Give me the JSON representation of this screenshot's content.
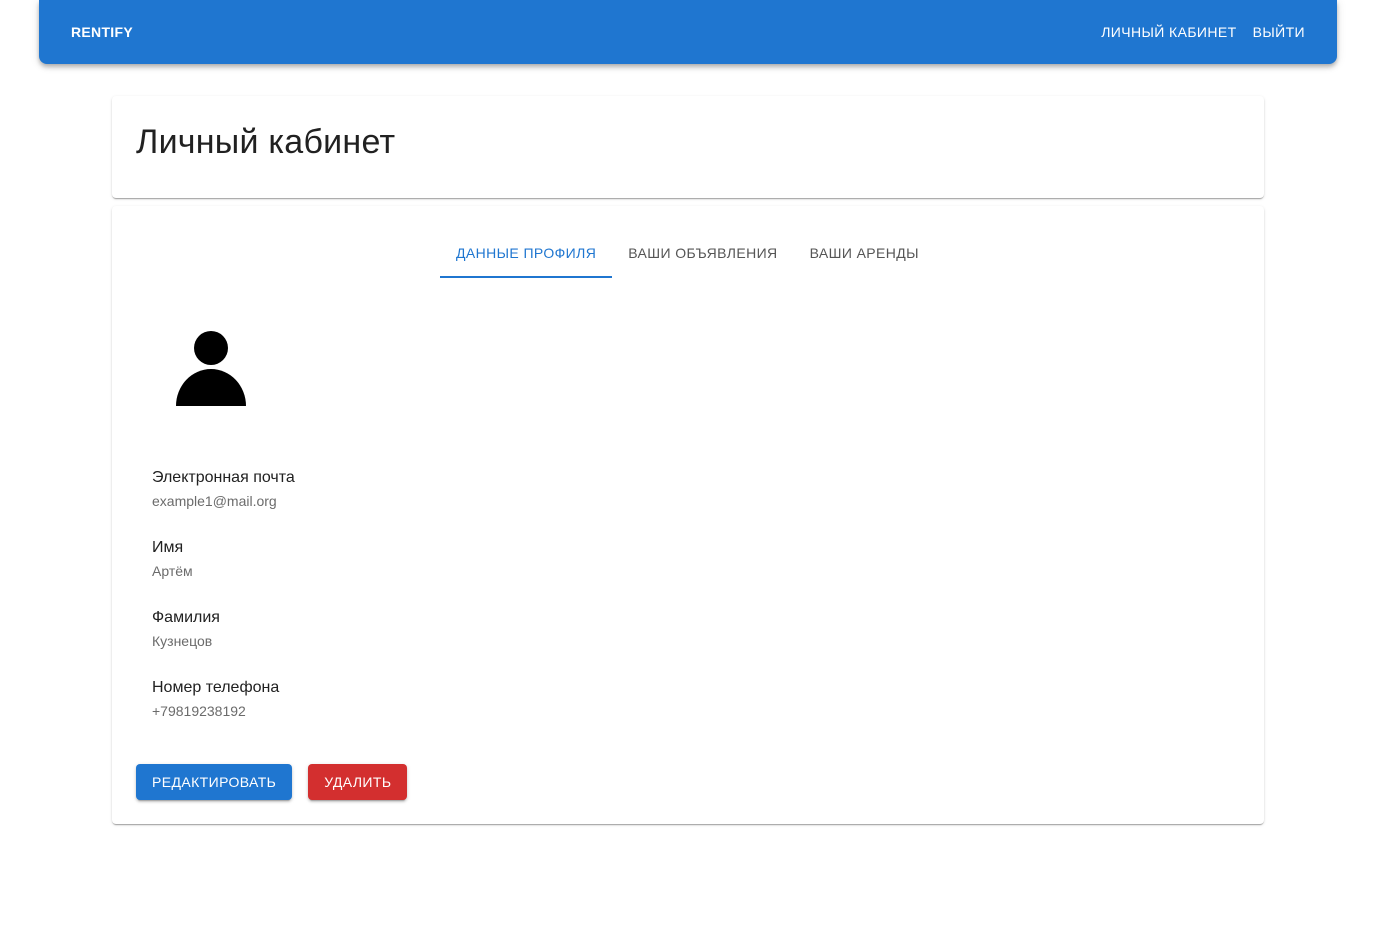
{
  "appbar": {
    "brand": "RENTIFY",
    "nav": [
      {
        "label": "ЛИЧНЫЙ КАБИНЕТ"
      },
      {
        "label": "ВЫЙТИ"
      }
    ],
    "accent_color": "#1f76d0"
  },
  "header": {
    "title": "Личный кабинет"
  },
  "tabs": [
    {
      "label": "ДАННЫЕ ПРОФИЛЯ",
      "active": true
    },
    {
      "label": "ВАШИ ОБЪЯВЛЕНИЯ",
      "active": false
    },
    {
      "label": "ВАШИ АРЕНДЫ",
      "active": false
    }
  ],
  "profile": {
    "avatar_icon": "person-icon",
    "fields": [
      {
        "label": "Электронная почта",
        "value": "example1@mail.org"
      },
      {
        "label": "Имя",
        "value": "Артём"
      },
      {
        "label": "Фамилия",
        "value": "Кузнецов"
      },
      {
        "label": "Номер телефона",
        "value": "+79819238192"
      }
    ]
  },
  "actions": {
    "edit_label": "РЕДАКТИРОВАТЬ",
    "delete_label": "УДАЛИТЬ",
    "delete_color": "#d32f2f"
  }
}
